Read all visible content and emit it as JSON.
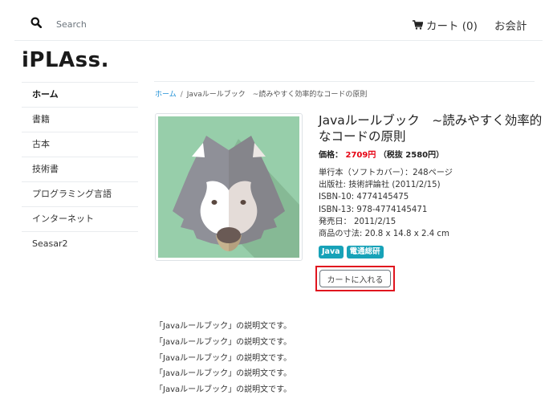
{
  "header": {
    "search_placeholder": "Search",
    "cart_label": "カート (0)",
    "checkout_label": "お会計"
  },
  "logo": "iPLAss.",
  "sidebar": {
    "items": [
      {
        "label": "ホーム",
        "active": true
      },
      {
        "label": "書籍"
      },
      {
        "label": "古本"
      },
      {
        "label": "技術書"
      },
      {
        "label": "プログラミング言語"
      },
      {
        "label": "インターネット"
      },
      {
        "label": "Seasar2"
      }
    ]
  },
  "breadcrumb": {
    "home": "ホーム",
    "separator": "/",
    "current": "Javaルールブック　~読みやすく効率的なコードの原則"
  },
  "product": {
    "title": "Javaルールブック　~読みやすく効率的なコードの原則",
    "price_label": "価格：",
    "price": "2709円",
    "price_excl_tax": "（税抜 2580円）",
    "specs": [
      "単行本（ソフトカバー）：248ページ",
      "出版社: 技術評論社 (2011/2/15)",
      "ISBN-10: 4774145475",
      "ISBN-13: 978-4774145471",
      "発売日： 2011/2/15",
      "商品の寸法: 20.8 x 14.8 x 2.4 cm"
    ],
    "tags": [
      "Java",
      "電通総研"
    ],
    "add_to_cart_label": "カートに入れる",
    "image_icon": "wolf-icon",
    "description_lines": [
      "「Javaルールブック」の説明文です。",
      "「Javaルールブック」の説明文です。",
      "「Javaルールブック」の説明文です。",
      "「Javaルールブック」の説明文です。",
      "「Javaルールブック」の説明文です。"
    ]
  },
  "colors": {
    "accent_link": "#1e90d6",
    "price_red": "#e60012",
    "tag_bg": "#17a2b8",
    "highlight_border": "#e0141e",
    "image_bg": "#97ceaa"
  }
}
